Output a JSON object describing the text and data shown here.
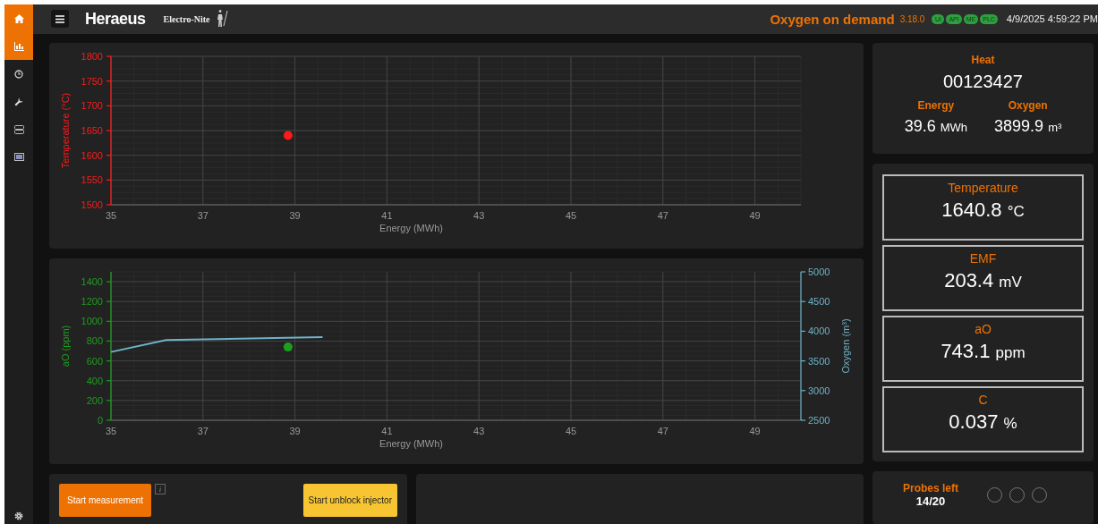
{
  "sidebar": {
    "items": [
      {
        "selected": true
      },
      {
        "selected": true
      },
      {
        "selected": false
      },
      {
        "selected": false
      },
      {
        "selected": false
      },
      {
        "selected": false
      }
    ]
  },
  "header": {
    "logo": "Heraeus",
    "sublogo": "Electro-Nite",
    "app_title": "Oxygen on demand",
    "version": "3.18.0",
    "status": [
      {
        "label": "UI",
        "color": "#2f9e3f"
      },
      {
        "label": "API",
        "color": "#2f9e3f"
      },
      {
        "label": "ME",
        "color": "#2f9e3f"
      },
      {
        "label": "PLC",
        "color": "#2f9e3f"
      }
    ],
    "datetime": "4/9/2025 4:59:22 PM"
  },
  "temperature_chart": {
    "chart_data": {
      "type": "scatter",
      "xlabel": "Energy (MWh)",
      "ylabel": "Temperature (°C)",
      "xlim": [
        35,
        50
      ],
      "ylim": [
        1500,
        1800
      ],
      "xticks": [
        35,
        37,
        39,
        41,
        43,
        45,
        47,
        49
      ],
      "yticks": [
        1500,
        1550,
        1600,
        1650,
        1700,
        1750,
        1800
      ],
      "grid": true,
      "series": [
        {
          "color": "#ff1a1a",
          "x": [
            38.85
          ],
          "values": [
            1640
          ]
        }
      ]
    }
  },
  "oxygen_chart": {
    "chart_data": {
      "type": "line",
      "xlabel": "Energy (MWh)",
      "ylabel": "aO (ppm)",
      "y2label": "Oxygen (m³)",
      "xlim": [
        35,
        50
      ],
      "ylim": [
        0,
        1500
      ],
      "y2lim": [
        2500,
        5000
      ],
      "xticks": [
        35,
        37,
        39,
        41,
        43,
        45,
        47,
        49
      ],
      "yticks": [
        0,
        200,
        400,
        600,
        800,
        1000,
        1200,
        1400
      ],
      "y2ticks": [
        2500,
        3000,
        3500,
        4000,
        4500,
        5000
      ],
      "grid": true,
      "series": [
        {
          "color": "#1e9e1e",
          "marker": true,
          "x": [
            38.85
          ],
          "values": [
            740
          ]
        },
        {
          "color": "#6fb3c8",
          "axis": "y2",
          "x": [
            35,
            36.2,
            39.6
          ],
          "values": [
            3650,
            3850,
            3900
          ]
        }
      ]
    }
  },
  "heat": {
    "label": "Heat",
    "value": "00123427",
    "energy": {
      "label": "Energy",
      "value": "39.6",
      "unit": "MWh"
    },
    "oxygen": {
      "label": "Oxygen",
      "value": "3899.9",
      "unit": "m³"
    }
  },
  "measurements": [
    {
      "label": "Temperature",
      "value": "1640.8",
      "unit": "°C"
    },
    {
      "label": "EMF",
      "value": "203.4",
      "unit": "mV"
    },
    {
      "label": "aO",
      "value": "743.1",
      "unit": "ppm"
    },
    {
      "label": "C",
      "value": "0.037",
      "unit": "%"
    }
  ],
  "actions": {
    "start_button": "Start measurement",
    "info": "i",
    "unblock_button": "Start unblock injector"
  },
  "probes": {
    "label": "Probes left",
    "value": "14/20",
    "slots": [
      {
        "filled": false
      },
      {
        "filled": false
      },
      {
        "filled": false
      }
    ]
  }
}
